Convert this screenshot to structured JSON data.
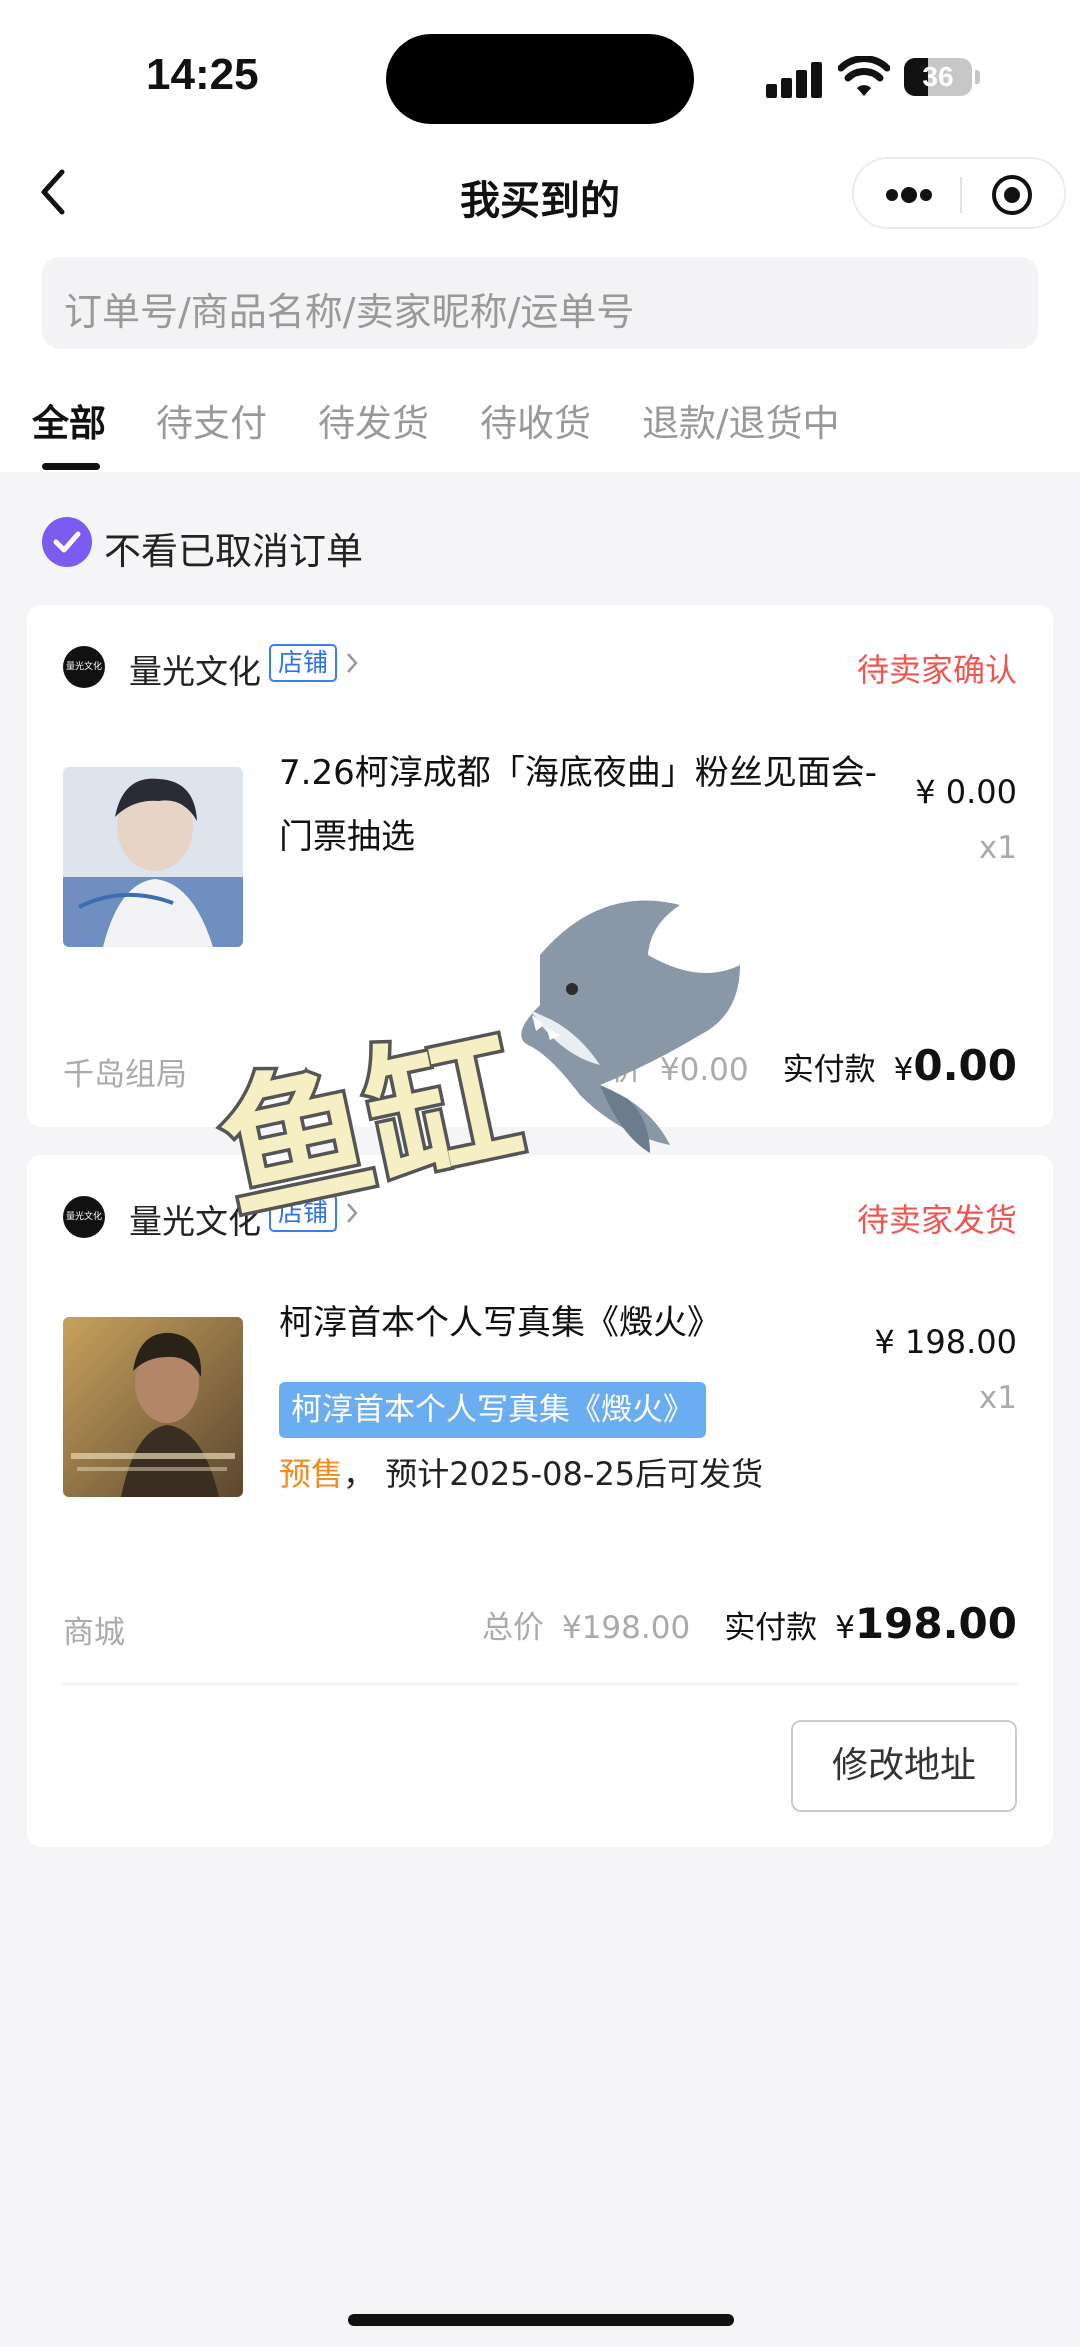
{
  "status_bar": {
    "time": "14:25",
    "battery": "36",
    "battery_level": 0.36
  },
  "nav": {
    "title": "我买到的"
  },
  "search": {
    "placeholder": "订单号/商品名称/卖家昵称/运单号"
  },
  "tabs": [
    {
      "label": "全部",
      "active": true
    },
    {
      "label": "待支付"
    },
    {
      "label": "待发货"
    },
    {
      "label": "待收货"
    },
    {
      "label": "退款/退货中"
    }
  ],
  "filter": {
    "label": "不看已取消订单",
    "checked": true
  },
  "orders": [
    {
      "shop_name": "量光文化",
      "shop_tag": "店铺",
      "logo_text": "量光文化",
      "status": "待卖家确认",
      "product_title": "7.26柯淳成都「海底夜曲」粉丝见面会-门票抽选",
      "price": "¥ 0.00",
      "qty": "x1",
      "source": "千岛组局",
      "total_label": "总价",
      "total_value": "¥0.00",
      "paid_label": "实付款",
      "paid_currency": "¥",
      "paid_amount": "0.00"
    },
    {
      "shop_name": "量光文化",
      "shop_tag": "店铺",
      "logo_text": "量光文化",
      "status": "待卖家发货",
      "product_title": "柯淳首本个人写真集《燬火》",
      "variant": "柯淳首本个人写真集《燬火》",
      "presale_tag": "预售",
      "presale_text": "，  预计2025-08-25后可发货",
      "price": "¥ 198.00",
      "qty": "x1",
      "source": "商城",
      "total_label": "总价",
      "total_value": "¥198.00",
      "paid_label": "实付款",
      "paid_currency": "¥",
      "paid_amount": "198.00",
      "action": "修改地址"
    }
  ],
  "sticker": {
    "text": "鱼缸",
    "icon": "shark-icon"
  },
  "colors": {
    "accent": "#7c5cf0",
    "status_red": "#f0564f",
    "presale_orange": "#f28c1c",
    "tag_blue": "#2f72e6",
    "variant_blue": "#6aaef1"
  }
}
